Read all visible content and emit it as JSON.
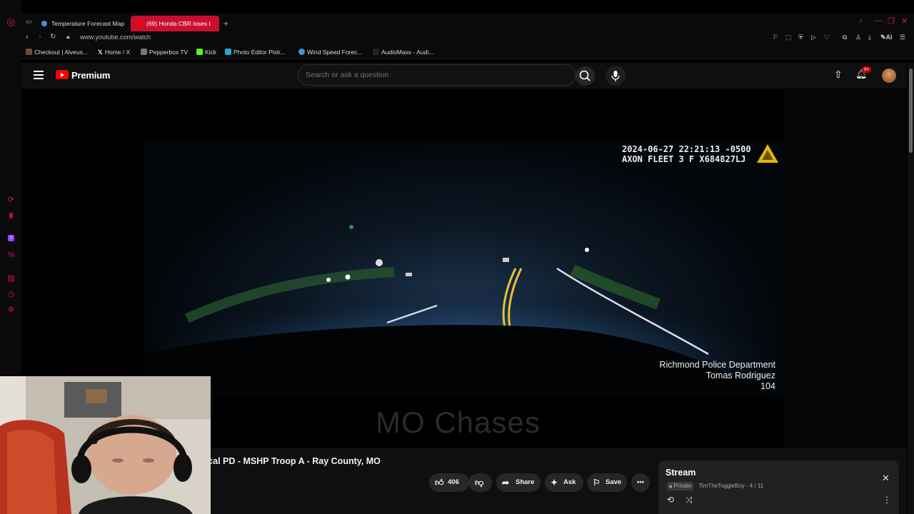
{
  "browser": {
    "tabs": [
      {
        "label": "Temperature Forecast Map",
        "active": false
      },
      {
        "label": "(69) Honda CBR loses t",
        "active": true
      }
    ],
    "url": "www.youtube.com/watch",
    "ai_label": "AI",
    "bookmarks": [
      {
        "label": "Checkout | Alveus...",
        "color": "#6b4f2a"
      },
      {
        "label": "Home / X",
        "color": "#000000"
      },
      {
        "label": "Pepperbox TV",
        "color": "#777777"
      },
      {
        "label": "Kick",
        "color": "#53fc18"
      },
      {
        "label": "Photo Editor Pixlr...",
        "color": "#2aa7d8"
      },
      {
        "label": "Wind Speed Forec...",
        "color": "#4a90d9"
      },
      {
        "label": "AudioMass - Audi...",
        "color": "#222222"
      }
    ],
    "accent": "#d4145a"
  },
  "youtube": {
    "logo_text": "Premium",
    "search_placeholder": "Search or ask a question",
    "notification_count": "9+",
    "video": {
      "overlay_timestamp": "2024-06-27 22:21:13 -0500",
      "overlay_device": "AXON FLEET 3 F X684827LJ",
      "credit_line1": "Richmond Police Department",
      "credit_line2": "Tomas Rodriguez",
      "credit_line3": "104",
      "watermark": "MO Chases"
    },
    "title": "he local PD - MSHP Troop A - Ray County, MO",
    "actions": {
      "like_count": "406",
      "share_label": "Share",
      "ask_label": "Ask",
      "save_label": "Save"
    },
    "playlist": {
      "title": "Stream",
      "privacy": "Private",
      "meta": "TimTheToggleBoy - 4 / 11"
    }
  }
}
